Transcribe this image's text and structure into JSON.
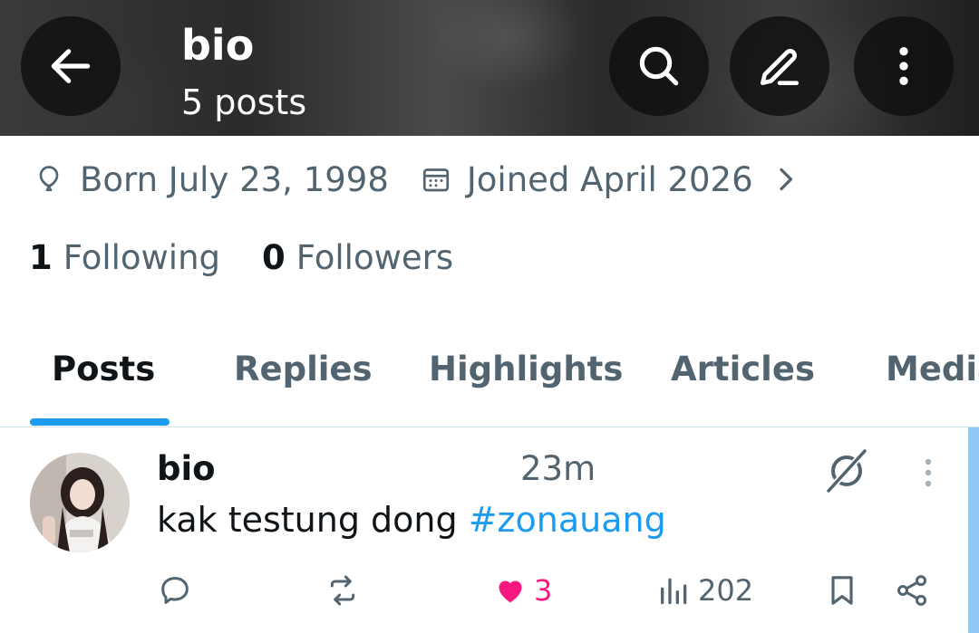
{
  "header": {
    "title": "bio",
    "subtitle": "5 posts"
  },
  "profile": {
    "born": "Born July 23, 1998",
    "joined": "Joined April 2026",
    "following_count": "1",
    "following_label": "Following",
    "followers_count": "0",
    "followers_label": "Followers"
  },
  "tabs": [
    {
      "label": "Posts",
      "active": true
    },
    {
      "label": "Replies",
      "active": false
    },
    {
      "label": "Highlights",
      "active": false
    },
    {
      "label": "Articles",
      "active": false
    },
    {
      "label": "Media",
      "active": false
    }
  ],
  "post": {
    "author": "bio",
    "time": "23m",
    "text": "kak testung dong ",
    "hashtag": "#zonauang",
    "likes": "3",
    "views": "202"
  },
  "colors": {
    "accent": "#1d9bf0",
    "like": "#f91880",
    "muted": "#536471",
    "text": "#0f1419"
  },
  "icons": [
    "back-arrow-icon",
    "search-icon",
    "edit-icon",
    "more-vertical-icon",
    "balloon-icon",
    "calendar-icon",
    "chevron-right-icon",
    "grok-icon",
    "reply-icon",
    "repost-icon",
    "heart-icon",
    "views-icon",
    "bookmark-icon",
    "share-icon"
  ]
}
